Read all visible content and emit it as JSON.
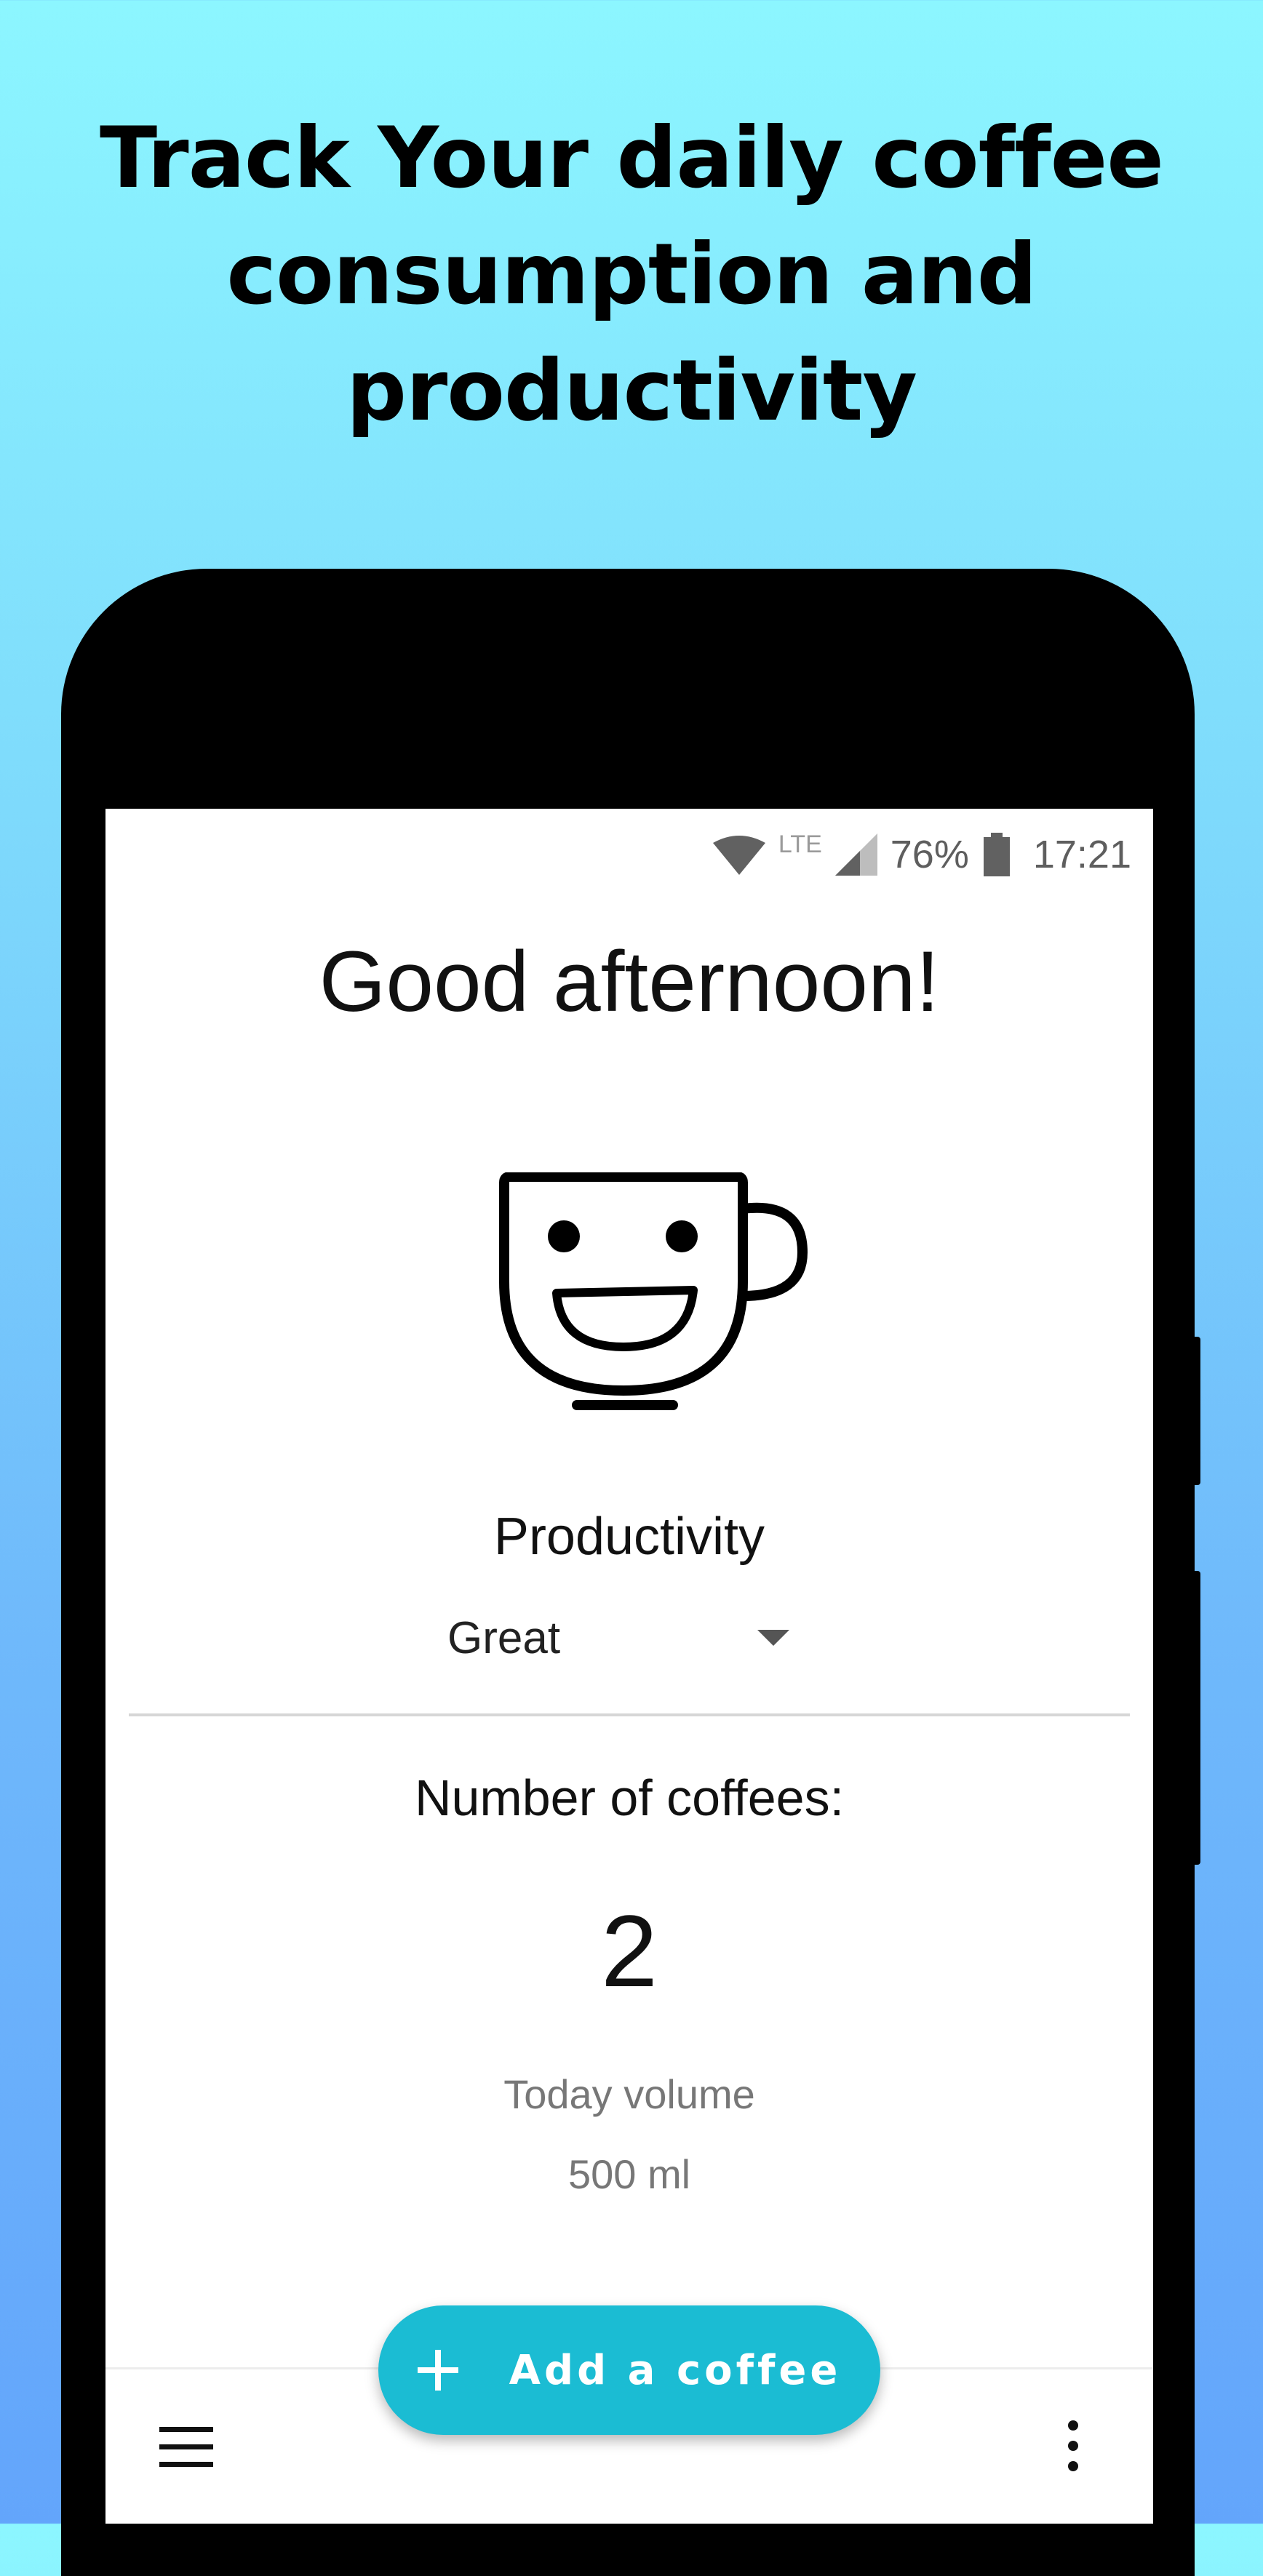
{
  "promo": {
    "headline_line1": "Track Your daily coffee",
    "headline_line2": "consumption and",
    "headline_line3": "productivity"
  },
  "status_bar": {
    "network": "LTE",
    "battery_percent": "76%",
    "time": "17:21",
    "icons": [
      "wifi-icon",
      "cell-signal-icon",
      "battery-icon"
    ]
  },
  "main": {
    "greeting": "Good afternoon!",
    "mood_icon": "happy-mug-icon",
    "productivity_label": "Productivity",
    "productivity_selected": "Great",
    "coffees_label": "Number of coffees:",
    "coffees_count": "2",
    "volume_label": "Today volume",
    "volume_value": "500 ml"
  },
  "actions": {
    "fab_label": "Add a coffee",
    "menu_icon": "menu-icon",
    "more_icon": "more-vert-icon"
  },
  "colors": {
    "fab": "#1bbcd3",
    "background_top": "#8cf6ff",
    "background_bottom": "#63a5fb"
  }
}
